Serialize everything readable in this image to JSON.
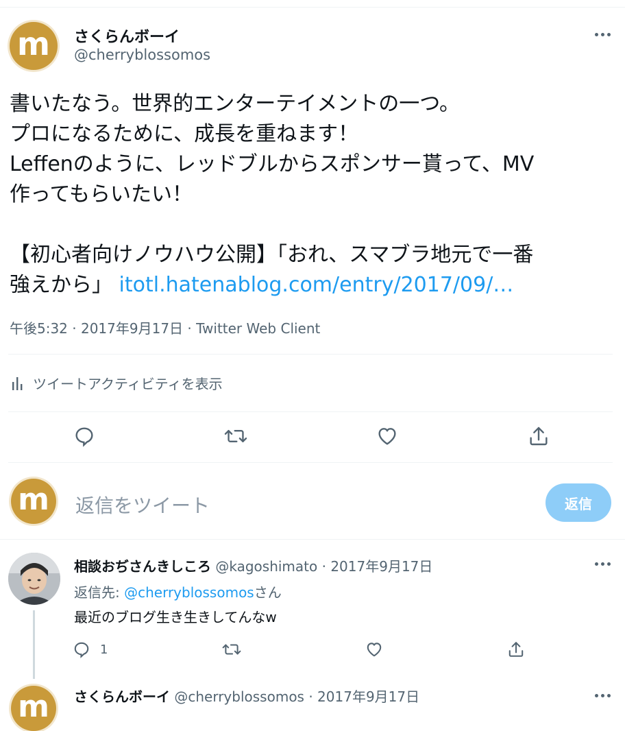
{
  "tweet": {
    "author_name": "さくらんボーイ",
    "author_handle": "@cherryblossomos",
    "avatar_letter": "m",
    "body_lines": [
      "書いたなう。世界的エンターテイメントの一つ。",
      "プロになるために、成長を重ねます！",
      "Leffenのように、レッドブルからスポンサー貰って、MV",
      "作ってもらいたい！"
    ],
    "body_line5": "【初心者向けノウハウ公開】「おれ、スマブラ地元で一番",
    "body_line6_text": "強えから」 ",
    "link_text": "itotl.hatenablog.com/entry/2017/09/…",
    "meta": "午後5:32 · 2017年9月17日 · Twitter Web Client",
    "activity_label": "ツイートアクティビティを表示"
  },
  "reply_box": {
    "placeholder": "返信をツイート",
    "button_label": "返信",
    "avatar_letter": "m"
  },
  "reply1": {
    "name": "相談おぢさんきしころ",
    "handle_date": "@kagoshimato · 2017年9月17日",
    "reply_to_prefix": "返信先: ",
    "reply_to_handle": "@cherryblossomos",
    "reply_to_suffix": "さん",
    "text": "最近のブログ生き生きしてんなw",
    "reply_count": "1"
  },
  "reply2": {
    "name": "さくらんボーイ",
    "handle_date": "@cherryblossomos · 2017年9月17日",
    "avatar_letter": "m"
  },
  "colors": {
    "accent": "#1d9bf0",
    "reply_button_bg": "#8ecdf8",
    "avatar": "#c99a3a",
    "secondary_text": "#536471",
    "divider": "#eff3f4"
  }
}
